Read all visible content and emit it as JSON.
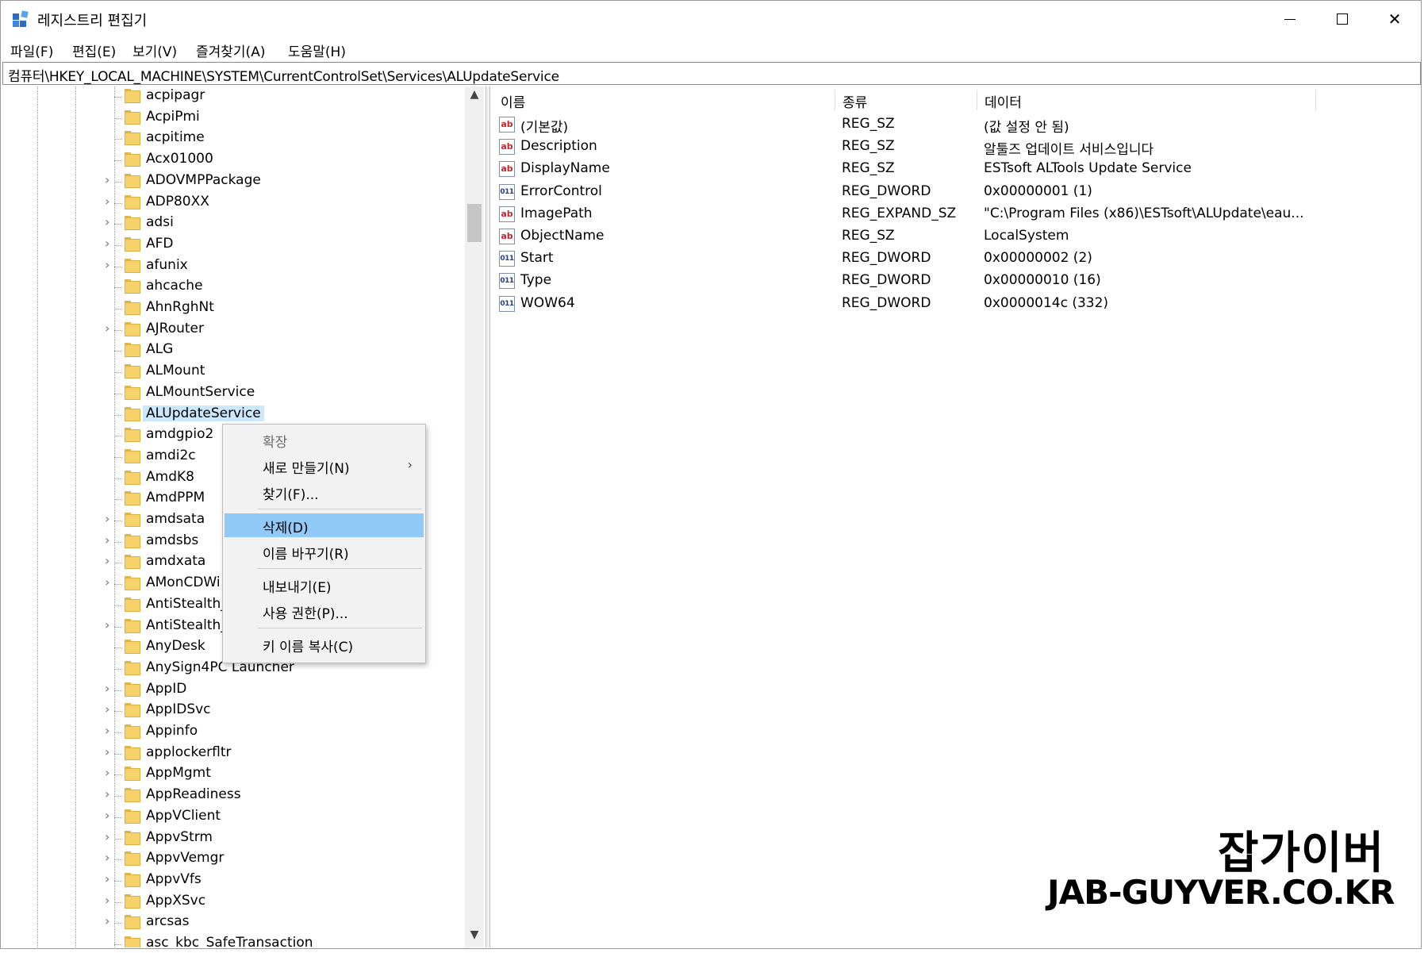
{
  "window": {
    "title": "레지스트리 편집기"
  },
  "menu": [
    "파일(F)",
    "편집(E)",
    "보기(V)",
    "즐겨찾기(A)",
    "도움말(H)"
  ],
  "address": "컴퓨터\\HKEY_LOCAL_MACHINE\\SYSTEM\\CurrentControlSet\\Services\\ALUpdateService",
  "tree": {
    "selected": "ALUpdateService",
    "items": [
      {
        "label": "acpipagr",
        "expandable": false
      },
      {
        "label": "AcpiPmi",
        "expandable": false
      },
      {
        "label": "acpitime",
        "expandable": false
      },
      {
        "label": "Acx01000",
        "expandable": false
      },
      {
        "label": "ADOVMPPackage",
        "expandable": true
      },
      {
        "label": "ADP80XX",
        "expandable": true
      },
      {
        "label": "adsi",
        "expandable": true
      },
      {
        "label": "AFD",
        "expandable": true
      },
      {
        "label": "afunix",
        "expandable": true
      },
      {
        "label": "ahcache",
        "expandable": false
      },
      {
        "label": "AhnRghNt",
        "expandable": false
      },
      {
        "label": "AJRouter",
        "expandable": true
      },
      {
        "label": "ALG",
        "expandable": false
      },
      {
        "label": "ALMount",
        "expandable": false
      },
      {
        "label": "ALMountService",
        "expandable": false
      },
      {
        "label": "ALUpdateService",
        "expandable": false
      },
      {
        "label": "amdgpio2",
        "expandable": false
      },
      {
        "label": "amdi2c",
        "expandable": false
      },
      {
        "label": "AmdK8",
        "expandable": false
      },
      {
        "label": "AmdPPM",
        "expandable": false
      },
      {
        "label": "amdsata",
        "expandable": true
      },
      {
        "label": "amdsbs",
        "expandable": true
      },
      {
        "label": "amdxata",
        "expandable": true
      },
      {
        "label": "AMonCDWi",
        "expandable": true
      },
      {
        "label": "AntiStealth_",
        "expandable": false
      },
      {
        "label": "AntiStealth_",
        "expandable": true
      },
      {
        "label": "AnyDesk",
        "expandable": false
      },
      {
        "label": "AnySign4PC Launcher",
        "expandable": false
      },
      {
        "label": "AppID",
        "expandable": true
      },
      {
        "label": "AppIDSvc",
        "expandable": true
      },
      {
        "label": "Appinfo",
        "expandable": true
      },
      {
        "label": "applockerfltr",
        "expandable": true
      },
      {
        "label": "AppMgmt",
        "expandable": true
      },
      {
        "label": "AppReadiness",
        "expandable": true
      },
      {
        "label": "AppVClient",
        "expandable": true
      },
      {
        "label": "AppvStrm",
        "expandable": true
      },
      {
        "label": "AppvVemgr",
        "expandable": true
      },
      {
        "label": "AppvVfs",
        "expandable": true
      },
      {
        "label": "AppXSvc",
        "expandable": true
      },
      {
        "label": "arcsas",
        "expandable": true
      },
      {
        "label": "asc_kbc_SafeTransaction",
        "expandable": false
      }
    ]
  },
  "values": {
    "headers": {
      "name": "이름",
      "type": "종류",
      "data": "데이터"
    },
    "rows": [
      {
        "icon": "string-value-icon",
        "name": "(기본값)",
        "type": "REG_SZ",
        "data": "(값 설정 안 됨)"
      },
      {
        "icon": "string-value-icon",
        "name": "Description",
        "type": "REG_SZ",
        "data": "알툴즈 업데이트 서비스입니다"
      },
      {
        "icon": "string-value-icon",
        "name": "DisplayName",
        "type": "REG_SZ",
        "data": "ESTsoft ALTools Update Service"
      },
      {
        "icon": "binary-value-icon",
        "name": "ErrorControl",
        "type": "REG_DWORD",
        "data": "0x00000001 (1)"
      },
      {
        "icon": "string-value-icon",
        "name": "ImagePath",
        "type": "REG_EXPAND_SZ",
        "data": "\"C:\\Program Files (x86)\\ESTsoft\\ALUpdate\\eau..."
      },
      {
        "icon": "string-value-icon",
        "name": "ObjectName",
        "type": "REG_SZ",
        "data": "LocalSystem"
      },
      {
        "icon": "binary-value-icon",
        "name": "Start",
        "type": "REG_DWORD",
        "data": "0x00000002 (2)"
      },
      {
        "icon": "binary-value-icon",
        "name": "Type",
        "type": "REG_DWORD",
        "data": "0x00000010 (16)"
      },
      {
        "icon": "binary-value-icon",
        "name": "WOW64",
        "type": "REG_DWORD",
        "data": "0x0000014c (332)"
      }
    ]
  },
  "context_menu": {
    "expand": "확장",
    "new": "새로 만들기(N)",
    "find": "찾기(F)...",
    "delete": "삭제(D)",
    "rename": "이름 바꾸기(R)",
    "export": "내보내기(E)",
    "permissions": "사용 권한(P)...",
    "copy_key_name": "키 이름 복사(C)",
    "highlighted": "삭제(D)"
  },
  "watermark": {
    "title": "잡가이버",
    "url": "JAB-GUYVER.CO.KR"
  },
  "colors": {
    "selection": "#cce8ff",
    "menu_hover": "#91c9f7",
    "folder": "#f7d26a"
  }
}
